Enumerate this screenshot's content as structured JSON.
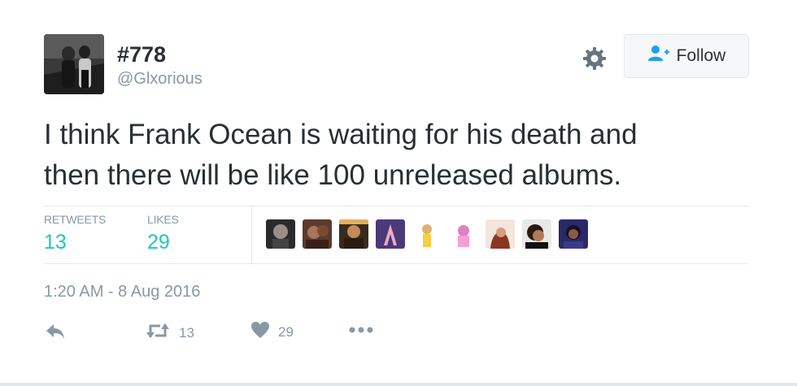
{
  "user": {
    "display_name": "#778",
    "handle": "@Glxorious"
  },
  "follow_button": {
    "label": "Follow"
  },
  "tweet": {
    "text_line1": "I think Frank Ocean is waiting for his death and",
    "text_line2": "then there will be like 100 unreleased albums."
  },
  "stats": {
    "retweets_label": "RETWEETS",
    "retweets_count": "13",
    "likes_label": "LIKES",
    "likes_count": "29"
  },
  "likers_count_shown": 9,
  "timestamp": "1:20 AM - 8 Aug 2016",
  "actions": {
    "reply_icon": "reply-icon",
    "retweet_icon": "retweet-icon",
    "retweet_count": "13",
    "like_icon": "heart-icon",
    "like_count": "29",
    "more_icon": "more-icon"
  },
  "colors": {
    "accent_teal": "#1dc9b7",
    "muted_gray": "#8899a6",
    "text_dark": "#292f33",
    "follow_icon_blue": "#1da1f2",
    "border": "#e1e8ed"
  }
}
